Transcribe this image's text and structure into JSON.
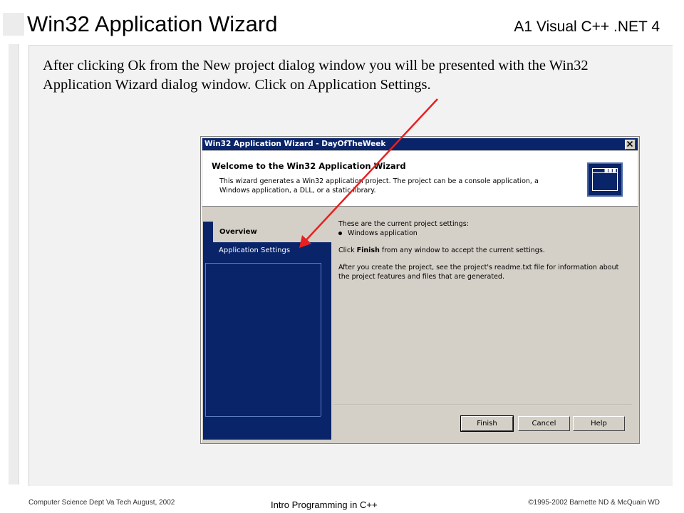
{
  "slide": {
    "title": "Win32 Application Wizard",
    "subtitle": "A1 Visual C++ .NET 4",
    "intro": "After clicking Ok from the New project dialog window you will be presented with the Win32 Application Wizard dialog window.  Click on Application Settings.",
    "footer_left": "Computer Science Dept Va Tech August, 2002",
    "footer_center": "Intro Programming in C++",
    "footer_right": "©1995-2002  Barnette ND & McQuain WD"
  },
  "dialog": {
    "title": "Win32 Application Wizard - DayOfTheWeek",
    "header_title": "Welcome to the Win32 Application Wizard",
    "header_desc": "This wizard generates a Win32 application project. The project can be a console application, a Windows application, a DLL, or a static library.",
    "nav": {
      "overview": "Overview",
      "application_settings": "Application Settings"
    },
    "content": {
      "settings_intro": "These are the current project settings:",
      "bullet": "Windows application",
      "finish_prefix": "Click ",
      "finish_word": "Finish",
      "finish_suffix": " from any window to accept the current settings.",
      "readme": "After you create the project, see the project's readme.txt file for information about the project features and files that are generated."
    },
    "buttons": {
      "finish": "Finish",
      "cancel": "Cancel",
      "help": "Help"
    }
  },
  "colors": {
    "titlebar": "#0a246a",
    "nav_pane": "#0a246a",
    "dialog_face": "#d4d0c8",
    "annotation_arrow": "#e8201f"
  },
  "icons": {
    "close": "close-x-icon",
    "wizard": "application-window-icon",
    "bullet": "bullet-dot-icon",
    "annotation": "red-arrow-icon"
  }
}
